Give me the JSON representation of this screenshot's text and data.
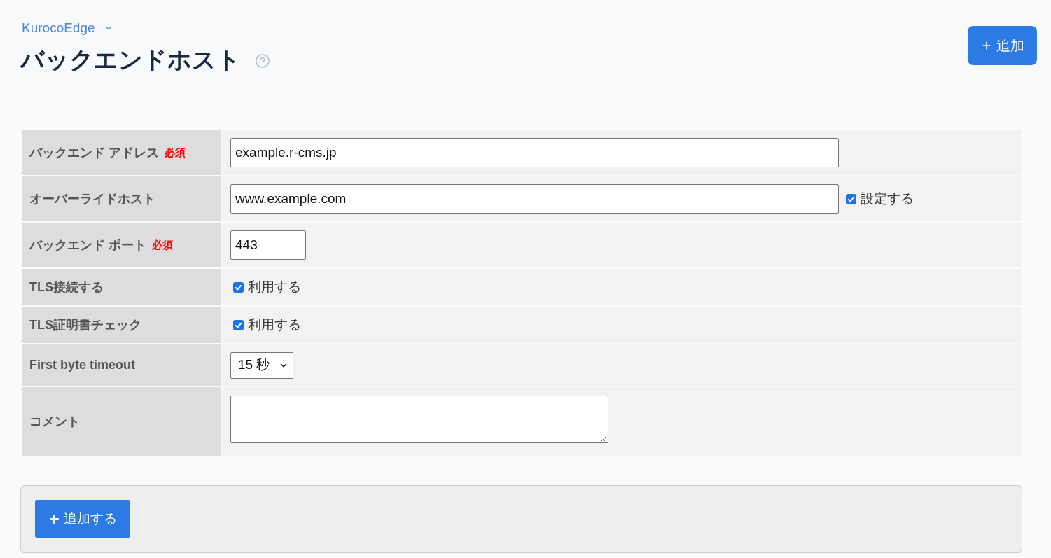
{
  "breadcrumb": {
    "label": "KurocoEdge"
  },
  "header": {
    "title": "バックエンドホスト",
    "add_button": {
      "label": "追加"
    }
  },
  "form": {
    "rows": [
      {
        "kind": "text",
        "label": "バックエンド アドレス",
        "required_mark": "必須",
        "value": "example.r-cms.jp"
      },
      {
        "kind": "text_with_checkbox",
        "label": "オーバーライドホスト",
        "value": "www.example.com",
        "option": {
          "label": "設定する",
          "checked": true
        }
      },
      {
        "kind": "short_text",
        "label": "バックエンド ポート",
        "required_mark": "必須",
        "value": "443"
      },
      {
        "kind": "checkbox",
        "label": "TLS接続する",
        "option": {
          "label": "利用する",
          "checked": true
        }
      },
      {
        "kind": "checkbox",
        "label": "TLS証明書チェック",
        "option": {
          "label": "利用する",
          "checked": true
        }
      },
      {
        "kind": "select",
        "label": "First byte timeout",
        "value": "15 秒"
      },
      {
        "kind": "textarea",
        "label": "コメント"
      }
    ]
  },
  "footer": {
    "submit_button": {
      "label": "追加する"
    }
  }
}
